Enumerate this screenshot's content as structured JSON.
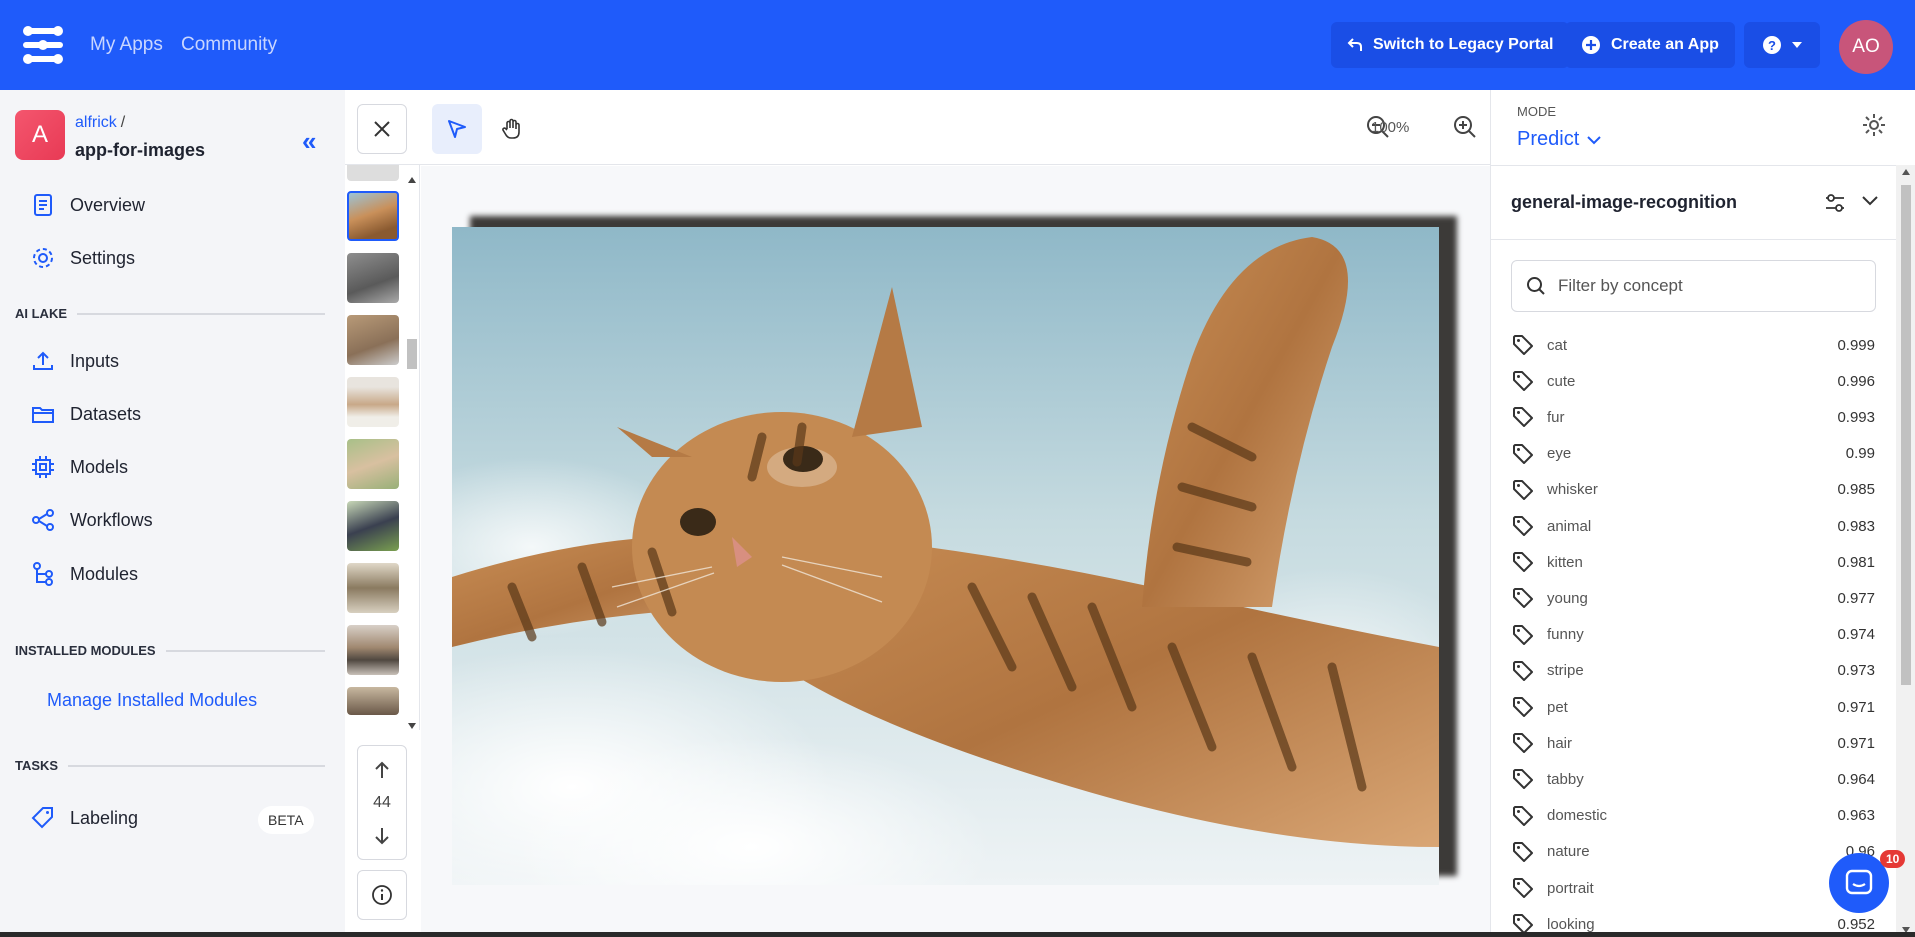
{
  "topbar": {
    "nav": [
      "My Apps",
      "Community"
    ],
    "legacy_button": "Switch to Legacy Portal",
    "create_button": "Create an App",
    "user_initials": "AO"
  },
  "sidebar": {
    "app_avatar": "A",
    "owner": "alfrick",
    "owner_sep": "/",
    "app_name": "app-for-images",
    "items_top": [
      {
        "label": "Overview",
        "icon": "document-icon"
      },
      {
        "label": "Settings",
        "icon": "gear-icon"
      }
    ],
    "section_ai_lake": "AI LAKE",
    "items_ai_lake": [
      {
        "label": "Inputs",
        "icon": "upload-icon"
      },
      {
        "label": "Datasets",
        "icon": "folder-icon"
      },
      {
        "label": "Models",
        "icon": "chip-icon"
      },
      {
        "label": "Workflows",
        "icon": "share-icon"
      },
      {
        "label": "Modules",
        "icon": "tree-icon"
      }
    ],
    "section_installed": "INSTALLED MODULES",
    "manage_link": "Manage Installed Modules",
    "section_tasks": "TASKS",
    "labeling": "Labeling",
    "labeling_badge": "BETA"
  },
  "toolbar": {
    "zoom": "100%"
  },
  "thumbnails": {
    "count": "44",
    "selected_index": 0
  },
  "right_panel": {
    "mode_label": "MODE",
    "mode_value": "Predict",
    "model_name": "general-image-recognition",
    "filter_placeholder": "Filter by concept",
    "concepts": [
      {
        "name": "cat",
        "value": "0.999"
      },
      {
        "name": "cute",
        "value": "0.996"
      },
      {
        "name": "fur",
        "value": "0.993"
      },
      {
        "name": "eye",
        "value": "0.99"
      },
      {
        "name": "whisker",
        "value": "0.985"
      },
      {
        "name": "animal",
        "value": "0.983"
      },
      {
        "name": "kitten",
        "value": "0.981"
      },
      {
        "name": "young",
        "value": "0.977"
      },
      {
        "name": "funny",
        "value": "0.974"
      },
      {
        "name": "stripe",
        "value": "0.973"
      },
      {
        "name": "pet",
        "value": "0.971"
      },
      {
        "name": "hair",
        "value": "0.971"
      },
      {
        "name": "tabby",
        "value": "0.964"
      },
      {
        "name": "domestic",
        "value": "0.963"
      },
      {
        "name": "nature",
        "value": "0.96"
      },
      {
        "name": "portrait",
        "value": ""
      },
      {
        "name": "looking",
        "value": "0.952"
      }
    ]
  },
  "chat": {
    "badge": "10"
  },
  "colors": {
    "brand": "#1f5bfa",
    "topbar": "#1f5bfa"
  }
}
